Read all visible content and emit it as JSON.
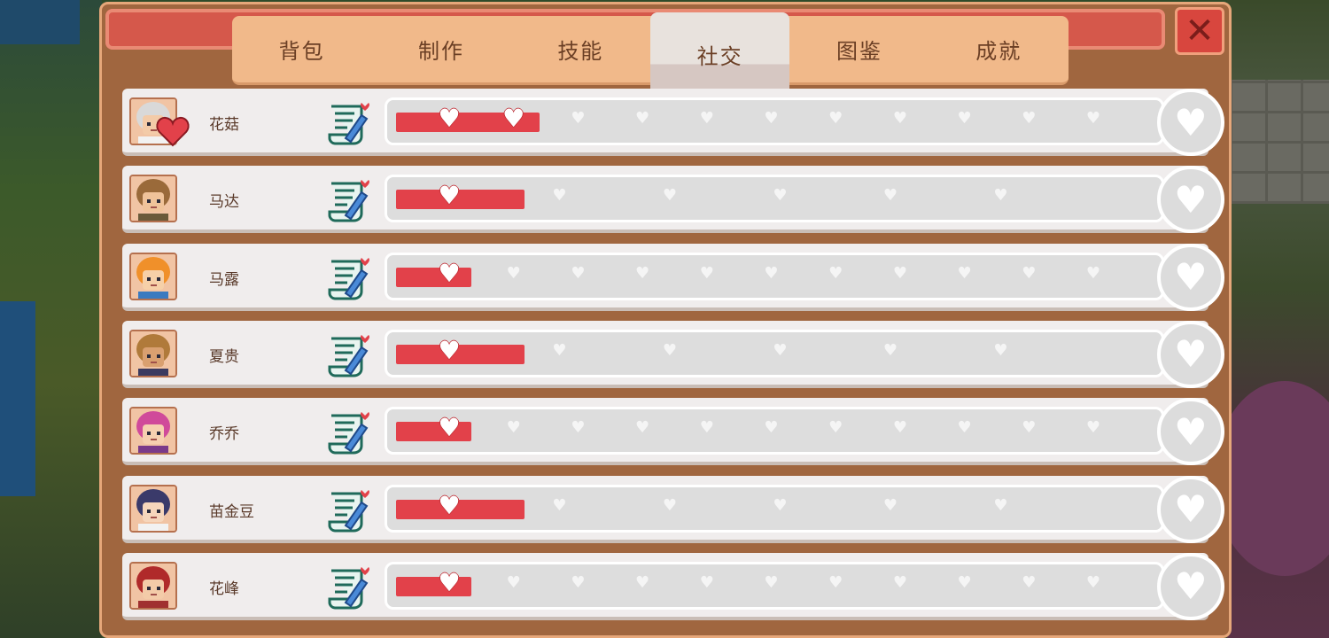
{
  "tabs": [
    {
      "label": "背包",
      "active": false
    },
    {
      "label": "制作",
      "active": false
    },
    {
      "label": "技能",
      "active": false
    },
    {
      "label": "社交",
      "active": true
    },
    {
      "label": "图鉴",
      "active": false
    },
    {
      "label": "成就",
      "active": false
    }
  ],
  "close_icon": "close-icon",
  "colors": {
    "panel": "#a0663f",
    "title_bar": "#d5584b",
    "tab_bg": "#f1b98a",
    "bar_fill": "#e2414a",
    "bar_track": "#dddddd"
  },
  "villagers": [
    {
      "name": "花菇",
      "heart_slots": 11,
      "hearts_filled": 2,
      "progress": 0.19,
      "is_lover": true,
      "hair": "#d9d9d9",
      "skin": "#f3cba8",
      "outfit": "#f2f2f2"
    },
    {
      "name": "马达",
      "heart_slots": 6,
      "hearts_filled": 1,
      "progress": 0.17,
      "is_lover": false,
      "hair": "#9a6a3a",
      "skin": "#f0c39a",
      "outfit": "#6a5a3a"
    },
    {
      "name": "马露",
      "heart_slots": 11,
      "hearts_filled": 1,
      "progress": 0.1,
      "is_lover": false,
      "hair": "#f0902a",
      "skin": "#f6d0a8",
      "outfit": "#3a7ac0"
    },
    {
      "name": "夏贵",
      "heart_slots": 6,
      "hearts_filled": 1,
      "progress": 0.17,
      "is_lover": false,
      "hair": "#b07a3a",
      "skin": "#d9a070",
      "outfit": "#3a3a60"
    },
    {
      "name": "乔乔",
      "heart_slots": 11,
      "hearts_filled": 1,
      "progress": 0.1,
      "is_lover": false,
      "hair": "#d04a9a",
      "skin": "#f6d0b0",
      "outfit": "#7a3a8a"
    },
    {
      "name": "苗金豆",
      "heart_slots": 6,
      "hearts_filled": 1,
      "progress": 0.17,
      "is_lover": false,
      "hair": "#3a3a6a",
      "skin": "#f6d6bc",
      "outfit": "#f2f2f2"
    },
    {
      "name": "花峰",
      "heart_slots": 11,
      "hearts_filled": 1,
      "progress": 0.1,
      "is_lover": false,
      "hair": "#b02a2a",
      "skin": "#f3cba8",
      "outfit": "#a03030"
    }
  ],
  "icons": {
    "gift": "gift-letter-icon",
    "max_heart": "heart-icon",
    "lover": "lover-heart-icon"
  }
}
